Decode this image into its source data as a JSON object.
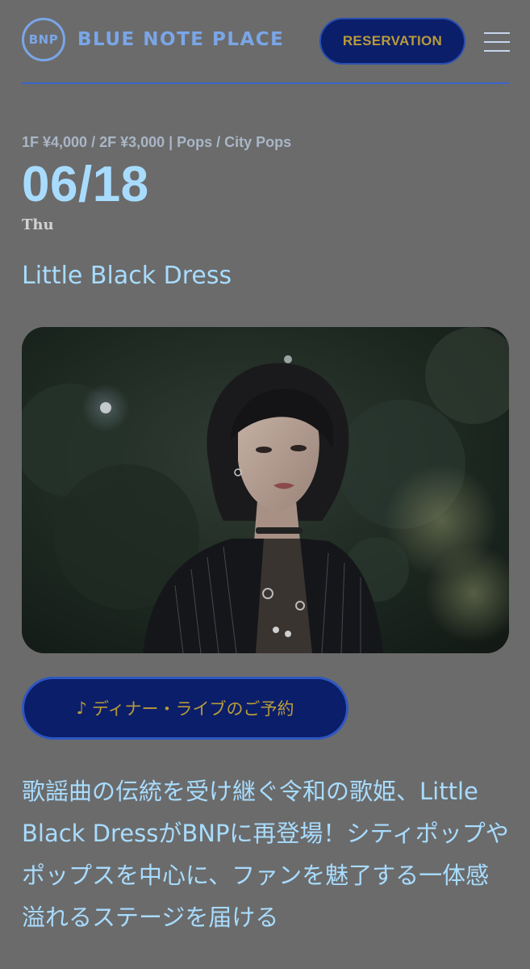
{
  "header": {
    "logo_badge": "BNP",
    "logo_text": "BLUE NOTE PLACE",
    "reservation_label": "RESERVATION",
    "menu_icon": "hamburger-menu-icon"
  },
  "event": {
    "meta": "1F ¥4,000 / 2F ¥3,000 | Pops / City Pops",
    "date": "06/18",
    "weekday": "Thu",
    "title": "Little Black Dress",
    "dinner_button_icon": "♪",
    "dinner_button_label": "ディナー・ライブのご予約",
    "description": "歌謡曲の伝統を受け継ぐ令和の歌姫、Little Black DressがBNPに再登場！シティポップやポップスを中心に、ファンを魅了する一体感溢れるステージを届ける"
  },
  "colors": {
    "background": "#6b6b6b",
    "accent_blue": "#a8dcff",
    "logo_blue": "#7aa6e8",
    "button_navy": "#0b1e6a",
    "button_gold": "#b89b3a"
  }
}
